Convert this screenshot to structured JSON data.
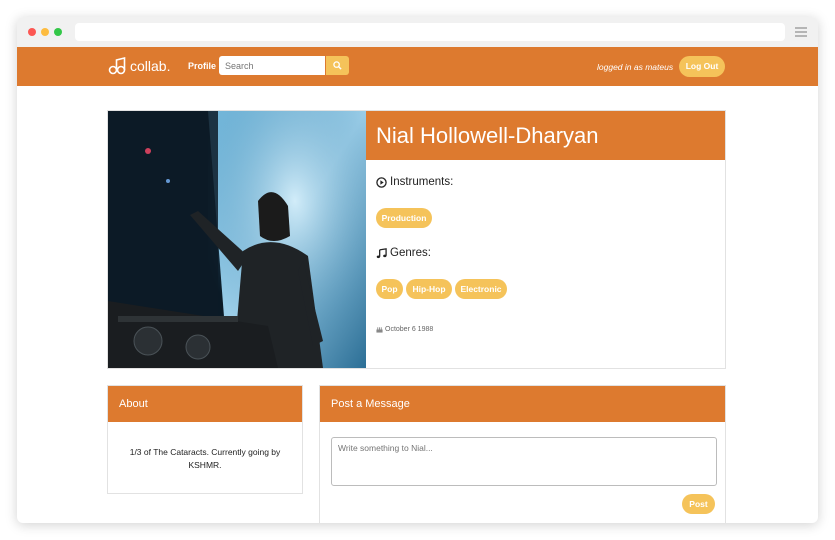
{
  "nav": {
    "logo_text": "collab.",
    "profile_label": "Profile",
    "search_placeholder": "Search",
    "logged_in_text": "logged in as mateus",
    "logout_label": "Log Out"
  },
  "profile": {
    "name": "Nial Hollowell-Dharyan",
    "instruments_heading": "Instruments:",
    "instruments": [
      "Production"
    ],
    "genres_heading": "Genres:",
    "genres": [
      "Pop",
      "Hip-Hop",
      "Electronic"
    ],
    "birthday": "October 6 1988"
  },
  "about": {
    "title": "About",
    "text": "1/3 of The Cataracts. Currently going by KSHMR."
  },
  "post": {
    "title": "Post a Message",
    "placeholder": "Write something to Nial...",
    "button_label": "Post"
  },
  "colors": {
    "brand_orange": "#dd7a2f",
    "accent_yellow": "#f5c35a"
  },
  "icons": {
    "instruments": "play-circle-icon",
    "genres": "music-note-icon",
    "birthday": "birthday-cake-icon",
    "search": "search-icon"
  }
}
